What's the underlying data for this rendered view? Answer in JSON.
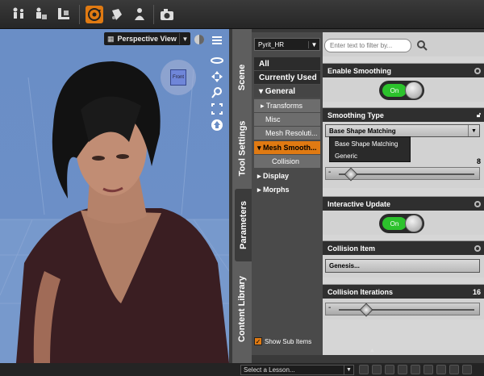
{
  "toolbar": {
    "tools": [
      {
        "icon": "figure-tool-icon",
        "active": false
      },
      {
        "icon": "node-tool-icon",
        "active": false
      },
      {
        "icon": "joint-editor-icon",
        "active": false
      },
      {
        "icon": "rotate-tool-icon",
        "active": true
      },
      {
        "icon": "surface-tool-icon",
        "active": false
      },
      {
        "icon": "figure-setup-icon",
        "active": false
      },
      {
        "icon": "camera-render-icon",
        "active": false
      }
    ]
  },
  "viewport": {
    "camera_label": "Perspective View",
    "cube_label": "Front",
    "tools": [
      "pan-icon",
      "move-icon",
      "zoom-icon",
      "frame-icon",
      "home-icon"
    ]
  },
  "side_tabs": [
    "Scene",
    "Tool Settings",
    "Parameters",
    "Content Library"
  ],
  "active_tab": "Parameters",
  "tree": {
    "node": "Pyrit_HR",
    "items": [
      {
        "label": "All"
      },
      {
        "label": "Currently Used"
      },
      {
        "label": "▾ General"
      },
      {
        "label": "▸ Transforms"
      },
      {
        "label": "Misc"
      },
      {
        "label": "Mesh Resoluti..."
      },
      {
        "label": "▾ Mesh Smooth..."
      },
      {
        "label": "Collision"
      },
      {
        "label": "▸ Display"
      },
      {
        "label": "▸ Morphs"
      }
    ],
    "show_sub_items": "Show Sub Items",
    "show_sub_checked": true
  },
  "filter": {
    "placeholder": "Enter text to filter by..."
  },
  "params": {
    "enable_smoothing": {
      "label": "Enable Smoothing",
      "state": "On"
    },
    "smoothing_type": {
      "label": "Smoothing Type",
      "value": "Base Shape Matching",
      "options": [
        "Base Shape Matching",
        "Generic"
      ]
    },
    "iterations": {
      "value": "8",
      "fraction": 0.06
    },
    "interactive_update": {
      "label": "Interactive Update",
      "state": "On"
    },
    "collision_item": {
      "label": "Collision Item",
      "value": "Genesis..."
    },
    "collision_iterations": {
      "label": "Collision Iterations",
      "value": "16",
      "fraction": 0.18
    }
  },
  "bottom": {
    "lesson_placeholder": "Select a Lesson..."
  },
  "colors": {
    "accent": "#e07a12",
    "on": "#2cc22c",
    "viewport": "#6a8ec6"
  }
}
